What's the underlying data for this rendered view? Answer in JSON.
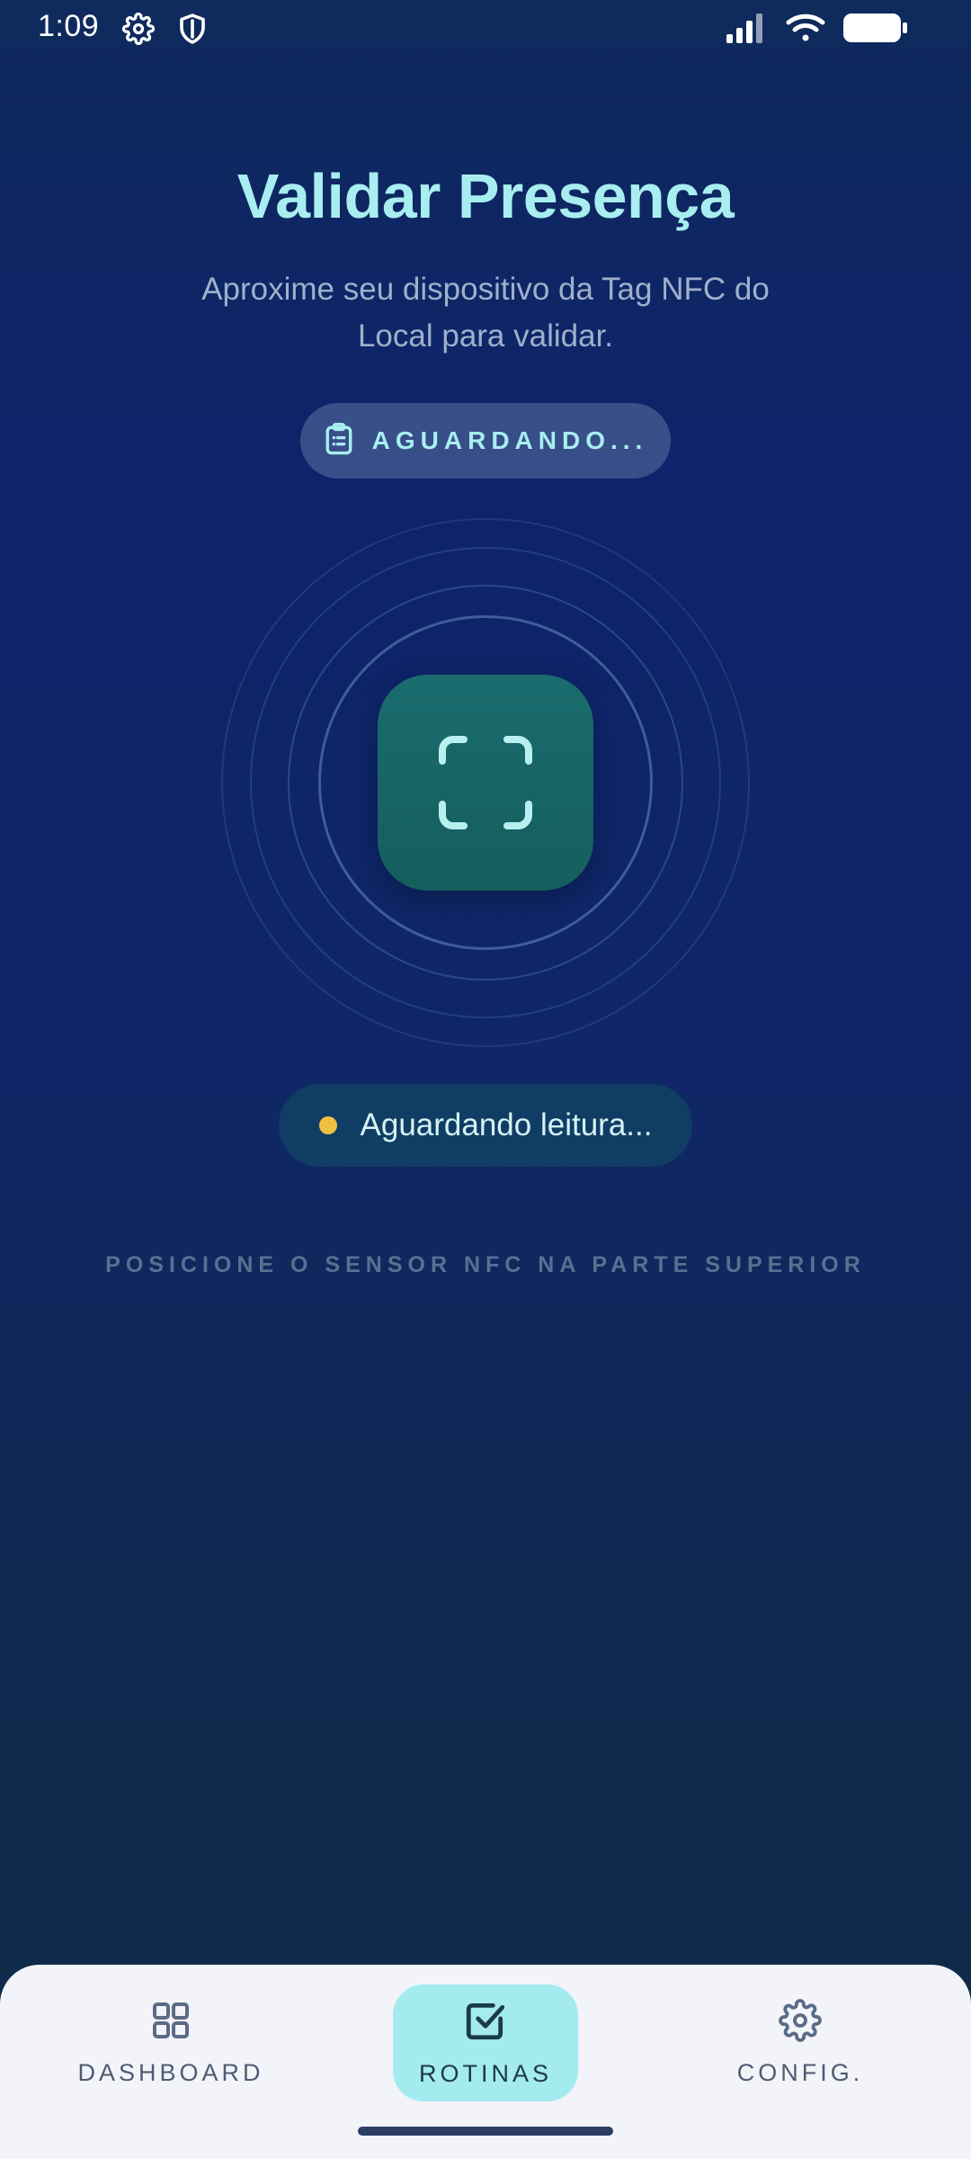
{
  "status_bar": {
    "time": "1:09",
    "left_icons": [
      "gear-icon",
      "shield-icon"
    ],
    "right_icons": [
      "signal-icon",
      "wifi-icon",
      "battery-icon"
    ]
  },
  "header": {
    "title": "Validar Presença",
    "subtitle": "Aproxime seu dispositivo da Tag NFC do Local para validar."
  },
  "status_pill": {
    "icon": "clipboard-icon",
    "label": "AGUARDANDO..."
  },
  "scanner": {
    "icon": "scan-frame-icon"
  },
  "reading_status": {
    "text": "Aguardando leitura...",
    "dot_color": "#f0c040"
  },
  "hint": {
    "text": "POSICIONE O SENSOR NFC NA PARTE SUPERIOR"
  },
  "bottom_nav": {
    "items": [
      {
        "label": "DASHBOARD",
        "icon": "grid-icon",
        "active": false
      },
      {
        "label": "ROTINAS",
        "icon": "checkbox-icon",
        "active": true
      },
      {
        "label": "CONFIG.",
        "icon": "gear-icon",
        "active": false
      }
    ]
  },
  "colors": {
    "accent": "#a8eef0",
    "scan_button": "#1a6c6e",
    "nav_active_bg": "#a3ebee",
    "nav_bg": "#f2f4f9"
  }
}
